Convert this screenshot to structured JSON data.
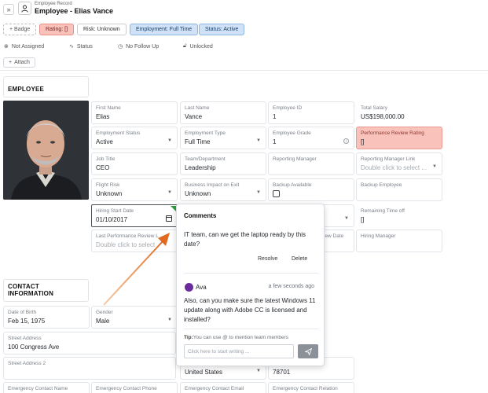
{
  "header": {
    "expand_icon": "double-chevron-right-icon",
    "record_icon": "person-icon",
    "subtitle": "Employee Record",
    "title": "Employee - Elias Vance"
  },
  "badges": {
    "add_label": "+ Badge",
    "rating": "Rating: []",
    "risk": "Risk: Unknown",
    "employment": "Employment: Full Time",
    "status": "Status: Active",
    "colors": {
      "rating_bg": "#f9c2bb",
      "active_bg": "#cfe2f7"
    }
  },
  "toolbar": {
    "assigned": "Not Assigned",
    "status": "Status",
    "followup": "No Follow Up",
    "lock": "Unlocked",
    "attach": "Attach"
  },
  "sections": {
    "employee": "EMPLOYEE",
    "contact": "CONTACT INFORMATION"
  },
  "fields": {
    "first_name": {
      "label": "First Name",
      "value": "Elias"
    },
    "last_name": {
      "label": "Last Name",
      "value": "Vance"
    },
    "employee_id": {
      "label": "Employee ID",
      "value": "1"
    },
    "total_salary": {
      "label": "Total Salary",
      "value": "US$198,000.00"
    },
    "employment_status": {
      "label": "Employment Status",
      "value": "Active"
    },
    "employment_type": {
      "label": "Employment Type",
      "value": "Full Time"
    },
    "employee_grade": {
      "label": "Employee Grade",
      "value": "1"
    },
    "perf_rating": {
      "label": "Performance Review Rating",
      "value": "[]"
    },
    "job_title": {
      "label": "Job Title",
      "value": "CEO"
    },
    "team": {
      "label": "Team/Department",
      "value": "Leadership"
    },
    "reporting_manager": {
      "label": "Reporting Manager",
      "value": ""
    },
    "reporting_link": {
      "label": "Reporting Manager Link",
      "value": "Double click to select ..."
    },
    "flight_risk": {
      "label": "Flight Risk",
      "value": "Unknown"
    },
    "business_impact": {
      "label": "Business Impact on Exit",
      "value": "Unknown"
    },
    "backup_available": {
      "label": "Backup Available"
    },
    "backup_employee": {
      "label": "Backup Employee",
      "value": ""
    },
    "hiring_start": {
      "label": "Hiring Start Date",
      "value": "01/10/2017"
    },
    "remaining_time": {
      "label": "Remaining Time off",
      "value": "[]"
    },
    "last_review": {
      "label": "Last Performance Review L",
      "value": "Double click to select"
    },
    "review_date_partial": {
      "label": "iew Date"
    },
    "hiring_manager": {
      "label": "Hiring Manager",
      "value": ""
    },
    "dob": {
      "label": "Date of Birth",
      "value": "Feb 15, 1975"
    },
    "gender": {
      "label": "Gender",
      "value": "Male"
    },
    "street1": {
      "label": "Street Address",
      "value": "100 Congress Ave"
    },
    "street2": {
      "label": "Street Address 2",
      "value": ""
    },
    "country": {
      "value": "United States"
    },
    "zip": {
      "value": "78701"
    },
    "ec_name": {
      "label": "Emergency Contact Name"
    },
    "ec_phone": {
      "label": "Emergency Contact Phone"
    },
    "ec_email": {
      "label": "Emergency Contact Email"
    },
    "ec_relation": {
      "label": "Emergency Contact Relation"
    }
  },
  "comments": {
    "title": "Comments",
    "message": "IT team, can we get the laptop ready by this date?",
    "resolve": "Resolve",
    "delete": "Delete",
    "author": "Ava",
    "time": "a few seconds ago",
    "reply": "Also, can you make sure the latest Windows 11 update along with Adobe CC is licensed and installed?",
    "tip_bold": "Tip:",
    "tip": "You can use @ to mention team members",
    "input_placeholder": "Click here to start writing ...",
    "send_icon": "send-icon"
  }
}
